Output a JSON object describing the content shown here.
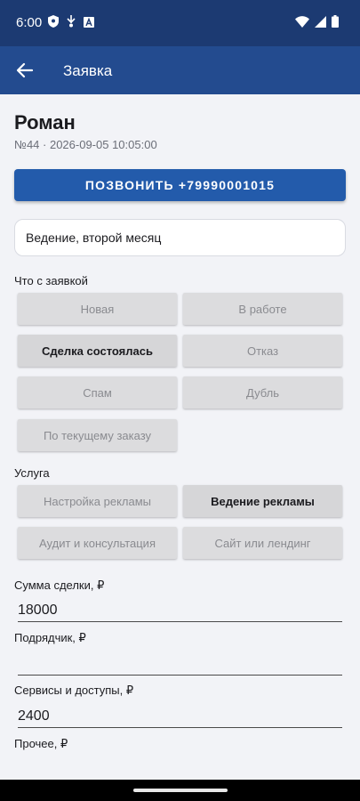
{
  "status_bar": {
    "time": "6:00",
    "icons_left": [
      "shield-icon",
      "usb-debug-icon",
      "text-a-icon"
    ],
    "icons_right": [
      "wifi-icon",
      "signal-icon",
      "battery-icon"
    ]
  },
  "app_bar": {
    "title": "Заявка",
    "back_icon": "arrow-left-icon"
  },
  "client": {
    "name": "Роман",
    "meta": "№44 · 2026-09-05 10:05:00"
  },
  "call_button": {
    "label": "ПОЗВОНИТЬ +79990001015"
  },
  "note": {
    "value": "Ведение, второй месяц"
  },
  "status_section": {
    "label": "Что с заявкой",
    "options": [
      {
        "label": "Новая",
        "selected": false
      },
      {
        "label": "В работе",
        "selected": false
      },
      {
        "label": "Сделка состоялась",
        "selected": true
      },
      {
        "label": "Отказ",
        "selected": false
      },
      {
        "label": "Спам",
        "selected": false
      },
      {
        "label": "Дубль",
        "selected": false
      },
      {
        "label": "По текущему заказу",
        "selected": false
      }
    ]
  },
  "service_section": {
    "label": "Услуга",
    "options": [
      {
        "label": "Настройка рекламы",
        "selected": false
      },
      {
        "label": "Ведение рекламы",
        "selected": true
      },
      {
        "label": "Аудит и консультация",
        "selected": false
      },
      {
        "label": "Сайт или лендинг",
        "selected": false
      }
    ]
  },
  "fields": {
    "deal_sum": {
      "label": "Сумма сделки, ₽",
      "value": "18000"
    },
    "contractor": {
      "label": "Подрядчик, ₽",
      "value": ""
    },
    "services": {
      "label": "Сервисы и доступы, ₽",
      "value": "2400"
    },
    "other": {
      "label": "Прочее, ₽"
    }
  },
  "colors": {
    "status_bar_bg": "#1c3a72",
    "app_bar_bg": "#234b8f",
    "accent": "#235bab",
    "page_bg": "#f2f3f7"
  }
}
